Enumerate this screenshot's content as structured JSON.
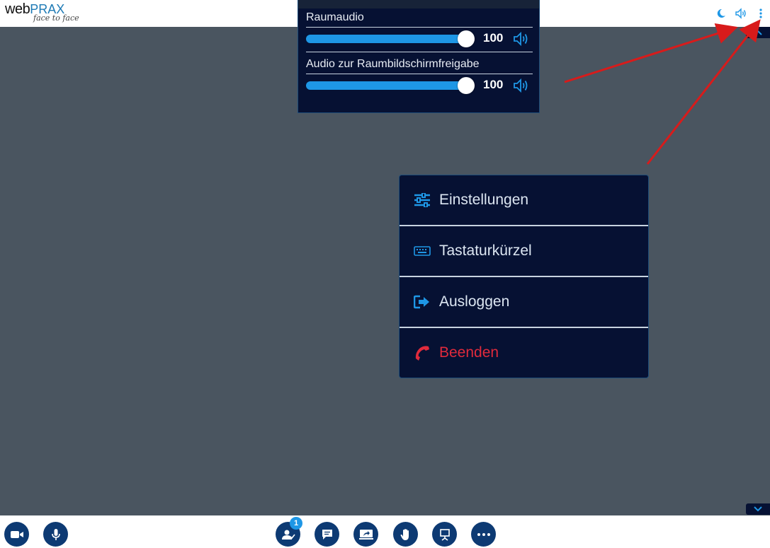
{
  "logo": {
    "brand_web": "web",
    "brand_prax": "PRAX",
    "tagline": "face to face"
  },
  "topbar": {
    "icons": [
      "theme-toggle-icon",
      "speaker-icon",
      "kebab-menu-icon"
    ]
  },
  "audio_panel": {
    "rows": [
      {
        "label": "Raumaudio",
        "volume": "100",
        "level": 1.0
      },
      {
        "label": "Audio zur Raumbildschirmfreigabe",
        "volume": "100",
        "level": 1.0
      }
    ]
  },
  "menu": {
    "items": [
      {
        "label": "Einstellungen",
        "icon": "sliders-icon"
      },
      {
        "label": "Tastaturkürzel",
        "icon": "keyboard-icon"
      },
      {
        "label": "Ausloggen",
        "icon": "logout-icon"
      },
      {
        "label": "Beenden",
        "icon": "phone-hangup-icon",
        "color": "#e02a3c"
      }
    ]
  },
  "toolbar": {
    "participants_count": "1",
    "buttons": [
      "camera",
      "microphone",
      "participants",
      "chat",
      "screen-share",
      "raise-hand",
      "whiteboard",
      "more"
    ]
  },
  "colors": {
    "accent": "#1e97e6",
    "panel_bg": "#061133",
    "stage_bg": "#4a5560",
    "danger": "#e02a3c",
    "button_bg": "#0d3a73"
  }
}
